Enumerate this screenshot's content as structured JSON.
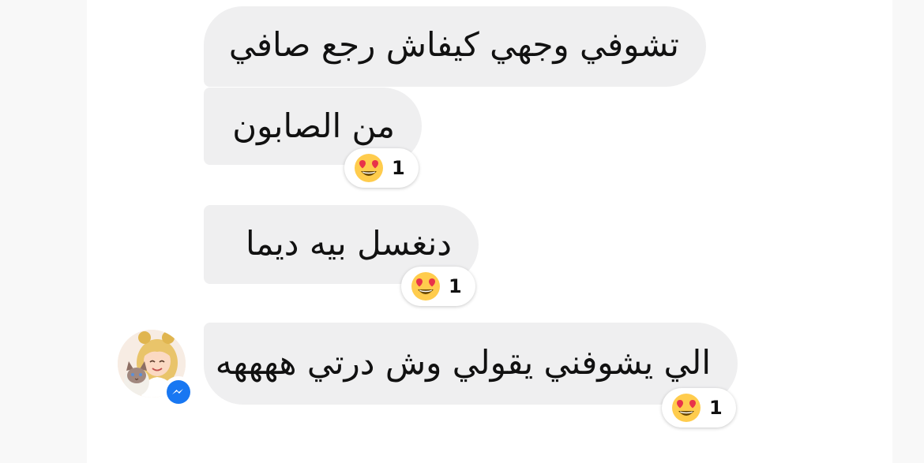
{
  "messages": [
    {
      "text": "تشوفي وجهي كيفاش رجع صافي"
    },
    {
      "text": "من الصابون",
      "reaction": {
        "emoji": "heart-eyes-emoji",
        "count": "1"
      }
    },
    {
      "text": "دنغسل بيه ديما",
      "reaction": {
        "emoji": "heart-eyes-emoji",
        "count": "1"
      }
    },
    {
      "text": "الي يشوفني يقولي وش درتي ههههه",
      "reaction": {
        "emoji": "heart-eyes-emoji",
        "count": "1"
      }
    }
  ],
  "sender": {
    "avatar": "avatar-girl-with-cat",
    "badge_icon": "messenger-icon"
  },
  "colors": {
    "bubble": "#efeff0",
    "text": "#111111",
    "messenger_blue": "#1877f2",
    "emoji_yellow": "#ffcc4d",
    "emoji_heart": "#e8334a"
  }
}
